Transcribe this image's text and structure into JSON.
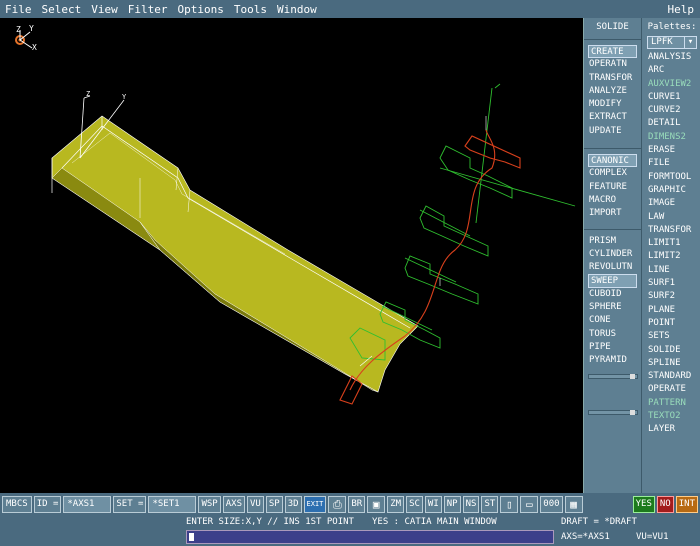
{
  "menubar": {
    "items": [
      "File",
      "Select",
      "View",
      "Filter",
      "Options",
      "Tools",
      "Window"
    ],
    "help": "Help"
  },
  "viewport": {
    "axis_labels": {
      "z": "Z",
      "y": "Y",
      "x": "X"
    },
    "colors": {
      "solid": "#b8b820",
      "solid_dark": "#8a8a10",
      "profile": "#2fbf2f",
      "spine": "#d8401c",
      "edges": "#ffffff"
    }
  },
  "sidebar": {
    "title": "SOLIDE",
    "palettes_label": "Palettes:",
    "palette_selected": "LPFK",
    "group1": [
      "CREATE",
      "OPERATN",
      "TRANSFOR",
      "ANALYZE",
      "MODIFY",
      "EXTRACT",
      "UPDATE"
    ],
    "group2": [
      "CANONIC",
      "COMPLEX",
      "FEATURE",
      "MACRO",
      "IMPORT"
    ],
    "group3": [
      "PRISM",
      "CYLINDER",
      "REVOLUTN",
      "SWEEP",
      "CUBOID",
      "SPHERE",
      "CONE",
      "TORUS",
      "PIPE",
      "PYRAMID"
    ],
    "palette_items": [
      "ANALYSIS",
      "ARC",
      "AUXVIEW2",
      "CURVE1",
      "CURVE2",
      "DETAIL",
      "DIMENS2",
      "ERASE",
      "FILE",
      "FORMTOOL",
      "GRAPHIC",
      "IMAGE",
      "LAW",
      "TRANSFOR",
      "LIMIT1",
      "LIMIT2",
      "LINE",
      "SURF1",
      "SURF2",
      "PLANE",
      "POINT",
      "SETS",
      "SOLIDE",
      "SPLINE",
      "STANDARD",
      "OPERATE",
      "PATTERN",
      "TEXTO2",
      "LAYER"
    ],
    "palette_dim": [
      "AUXVIEW2",
      "DIMENS2",
      "PATTERN",
      "TEXTO2"
    ]
  },
  "toolbar": {
    "mbcs": "MBCS",
    "id_label": "ID =",
    "id_value": "*AXS1",
    "set_label": "SET =",
    "set_value": "*SET1",
    "buttons": [
      "WSP",
      "AXS",
      "VU",
      "SP",
      "3D"
    ],
    "exit": "EXIT",
    "br": "BR",
    "buttons2": [
      "ZM",
      "SC",
      "WI",
      "NP",
      "NS",
      "ST"
    ],
    "counter": "000",
    "yes": "YES",
    "no": "NO",
    "int": "INT"
  },
  "status": {
    "prompt": "ENTER SIZE:X,Y // INS 1ST POINT",
    "yes_msg": "YES : CATIA MAIN WINDOW",
    "draft": "DRAFT = *DRAFT",
    "axs": "AXS=*AXS1",
    "vu": "VU=VU1"
  }
}
